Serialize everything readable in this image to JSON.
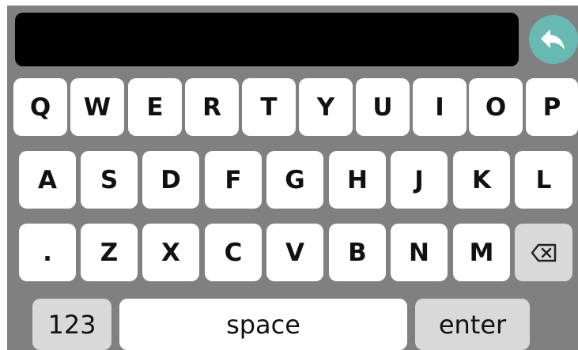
{
  "input": {
    "value": ""
  },
  "keyboard": {
    "row1": [
      "Q",
      "W",
      "E",
      "R",
      "T",
      "Y",
      "U",
      "I",
      "O",
      "P"
    ],
    "row2": [
      "A",
      "S",
      "D",
      "F",
      "G",
      "H",
      "J",
      "K",
      "L"
    ],
    "row3": [
      ".",
      "Z",
      "X",
      "C",
      "V",
      "B",
      "N",
      "M"
    ],
    "numbers_label": "123",
    "space_label": "space",
    "enter_label": "enter"
  },
  "icons": {
    "enter": "return-arrow-icon",
    "backspace": "backspace-icon"
  },
  "colors": {
    "keyboard_background": "#808080",
    "input_background": "#000000",
    "key_background": "#ffffff",
    "special_key_background": "#d9d9d9",
    "enter_button": "#69b9b3"
  }
}
